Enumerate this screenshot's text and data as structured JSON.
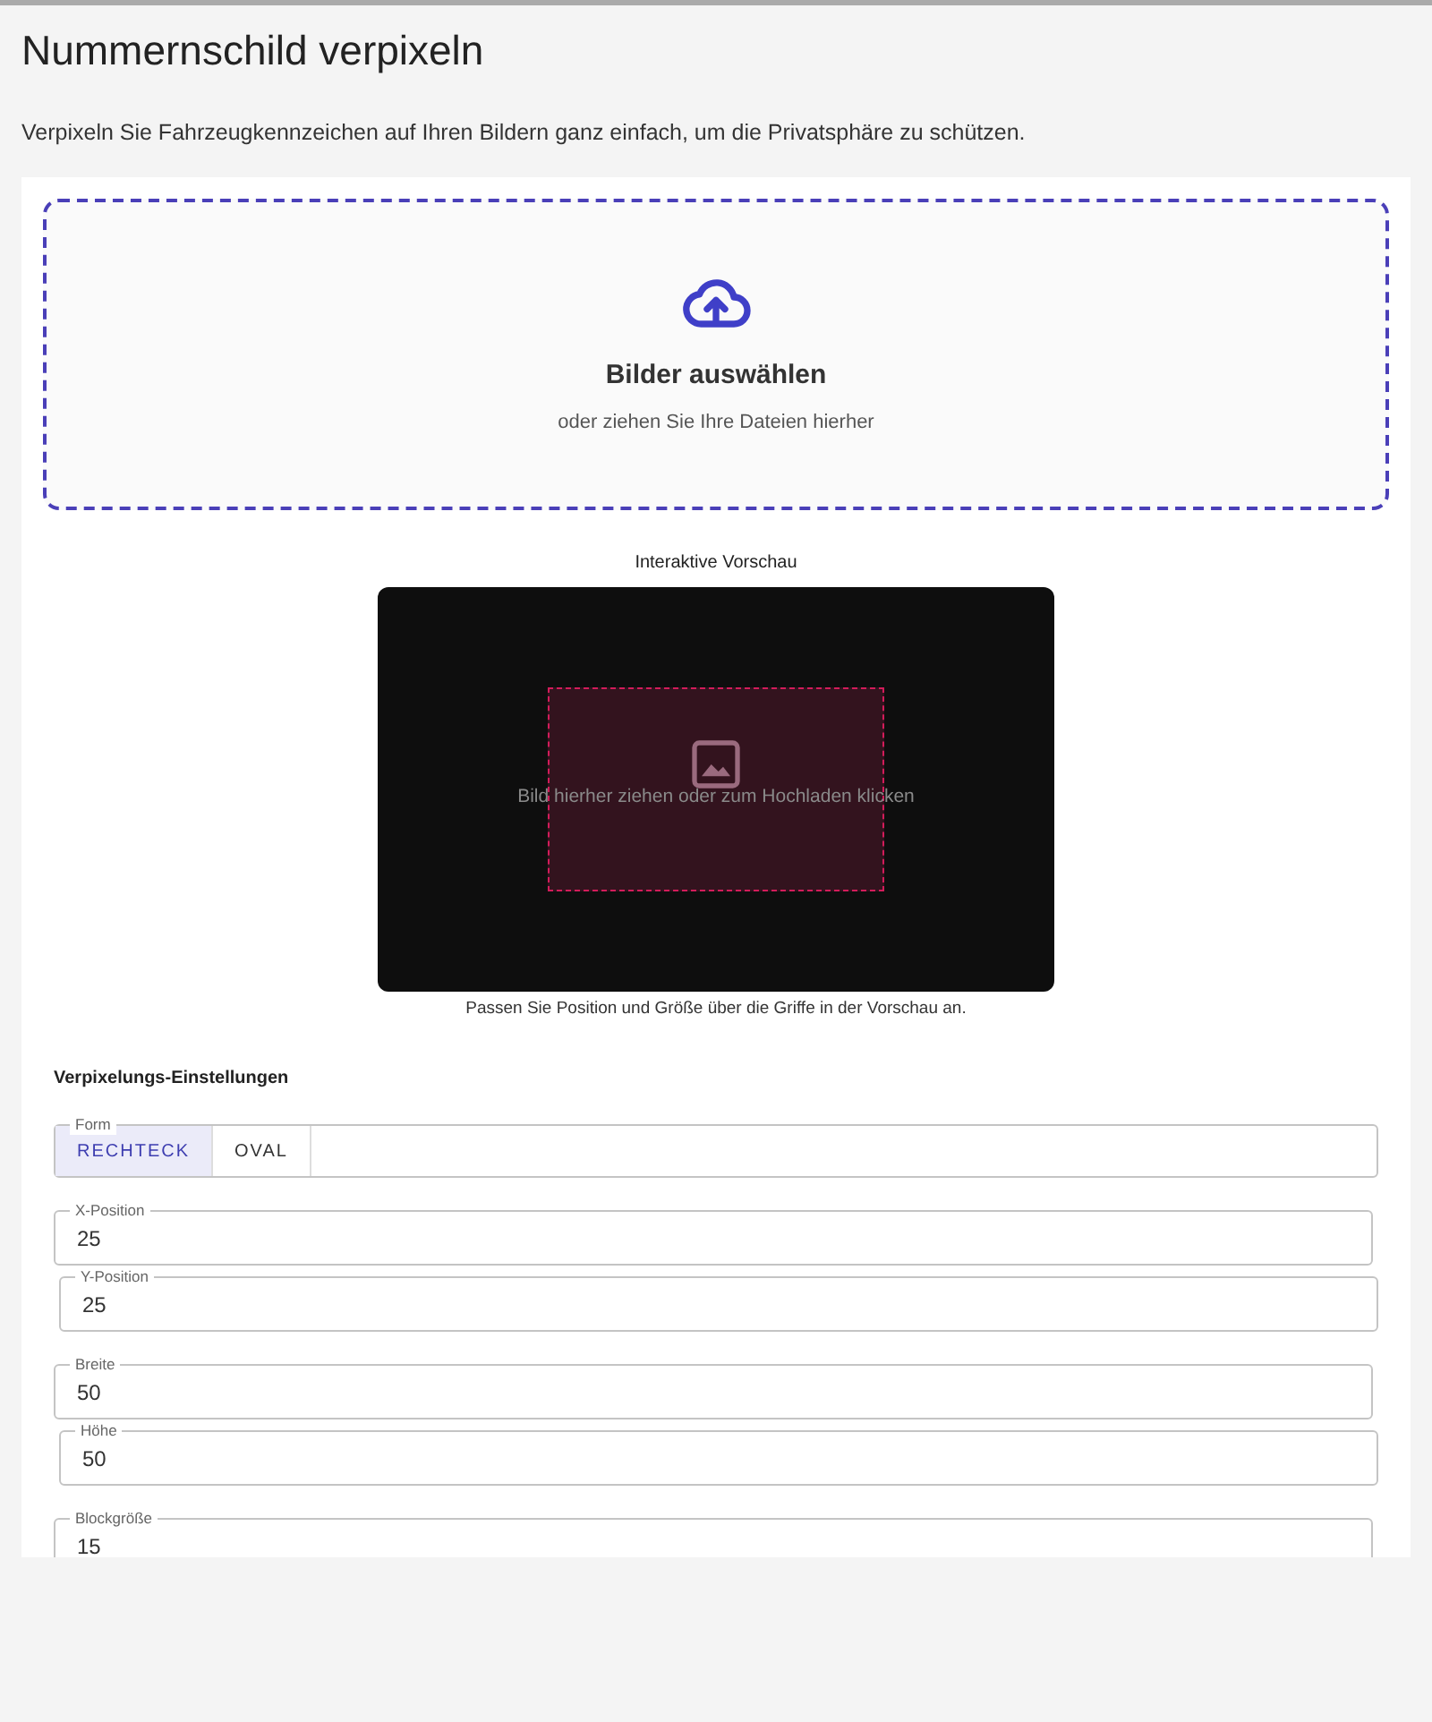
{
  "title": "Nummernschild verpixeln",
  "description": "Verpixeln Sie Fahrzeugkennzeichen auf Ihren Bildern ganz einfach, um die Privatsphäre zu schützen.",
  "upload": {
    "title": "Bilder auswählen",
    "hint": "oder ziehen Sie Ihre Dateien hierher"
  },
  "preview": {
    "title": "Interaktive Vorschau",
    "placeholder": "Bild hierher ziehen oder zum Hochladen klicken",
    "caption": "Passen Sie Position und Größe über die Griffe in der Vorschau an."
  },
  "settings": {
    "title": "Verpixelungs-Einstellungen",
    "shape": {
      "label": "Form",
      "options": [
        {
          "label": "RECHTECK",
          "selected": true
        },
        {
          "label": "OVAL",
          "selected": false
        }
      ]
    },
    "field_groups": [
      [
        {
          "label": "X-Position",
          "value": "25"
        },
        {
          "label": "Y-Position",
          "value": "25"
        }
      ],
      [
        {
          "label": "Breite",
          "value": "50"
        },
        {
          "label": "Höhe",
          "value": "50"
        }
      ],
      [
        {
          "label": "Blockgröße",
          "value": "15"
        }
      ]
    ]
  }
}
